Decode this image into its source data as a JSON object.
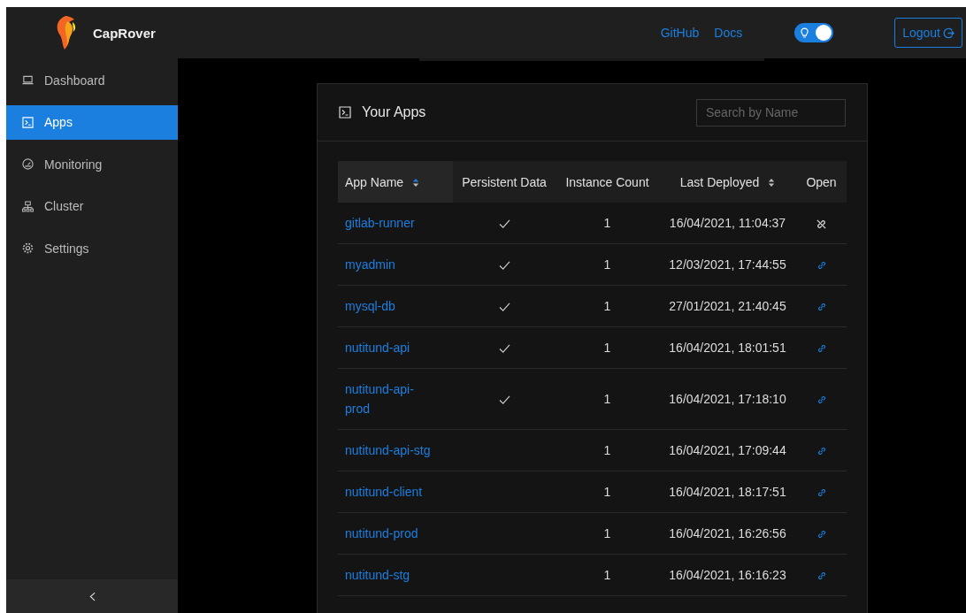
{
  "brand": {
    "name": "CapRover"
  },
  "header": {
    "links": [
      "GitHub",
      "Docs"
    ],
    "theme_toggle": {
      "on": true
    },
    "logout": "Logout"
  },
  "sidebar": {
    "items": [
      {
        "label": "Dashboard",
        "selected": false
      },
      {
        "label": "Apps",
        "selected": true
      },
      {
        "label": "Monitoring",
        "selected": false
      },
      {
        "label": "Cluster",
        "selected": false
      },
      {
        "label": "Settings",
        "selected": false
      }
    ]
  },
  "apps_card": {
    "title": "Your Apps",
    "search": {
      "placeholder": "Search by Name"
    },
    "table": {
      "columns": [
        {
          "label": "App Name",
          "sortable": true,
          "sorted": true
        },
        {
          "label": "Persistent Data"
        },
        {
          "label": "Instance Count"
        },
        {
          "label": "Last Deployed",
          "sortable": true,
          "sorted": false
        },
        {
          "label": "Open"
        }
      ],
      "rows": [
        {
          "name": "gitlab-runner",
          "persistent": true,
          "instances": "1",
          "last_deployed": "16/04/2021, 11:04:37",
          "link_enabled": false
        },
        {
          "name": "myadmin",
          "persistent": true,
          "instances": "1",
          "last_deployed": "12/03/2021, 17:44:55",
          "link_enabled": true
        },
        {
          "name": "mysql-db",
          "persistent": true,
          "instances": "1",
          "last_deployed": "27/01/2021, 21:40:45",
          "link_enabled": true
        },
        {
          "name": "nutitund-api",
          "persistent": true,
          "instances": "1",
          "last_deployed": "16/04/2021, 18:01:51",
          "link_enabled": true
        },
        {
          "name": "nutitund-api-prod",
          "persistent": true,
          "instances": "1",
          "last_deployed": "16/04/2021, 17:18:10",
          "link_enabled": true
        },
        {
          "name": "nutitund-api-stg",
          "persistent": false,
          "instances": "1",
          "last_deployed": "16/04/2021, 17:09:44",
          "link_enabled": true
        },
        {
          "name": "nutitund-client",
          "persistent": false,
          "instances": "1",
          "last_deployed": "16/04/2021, 18:17:51",
          "link_enabled": true
        },
        {
          "name": "nutitund-prod",
          "persistent": false,
          "instances": "1",
          "last_deployed": "16/04/2021, 16:26:56",
          "link_enabled": true
        },
        {
          "name": "nutitund-stg",
          "persistent": false,
          "instances": "1",
          "last_deployed": "16/04/2021, 16:16:23",
          "link_enabled": true
        }
      ]
    }
  }
}
